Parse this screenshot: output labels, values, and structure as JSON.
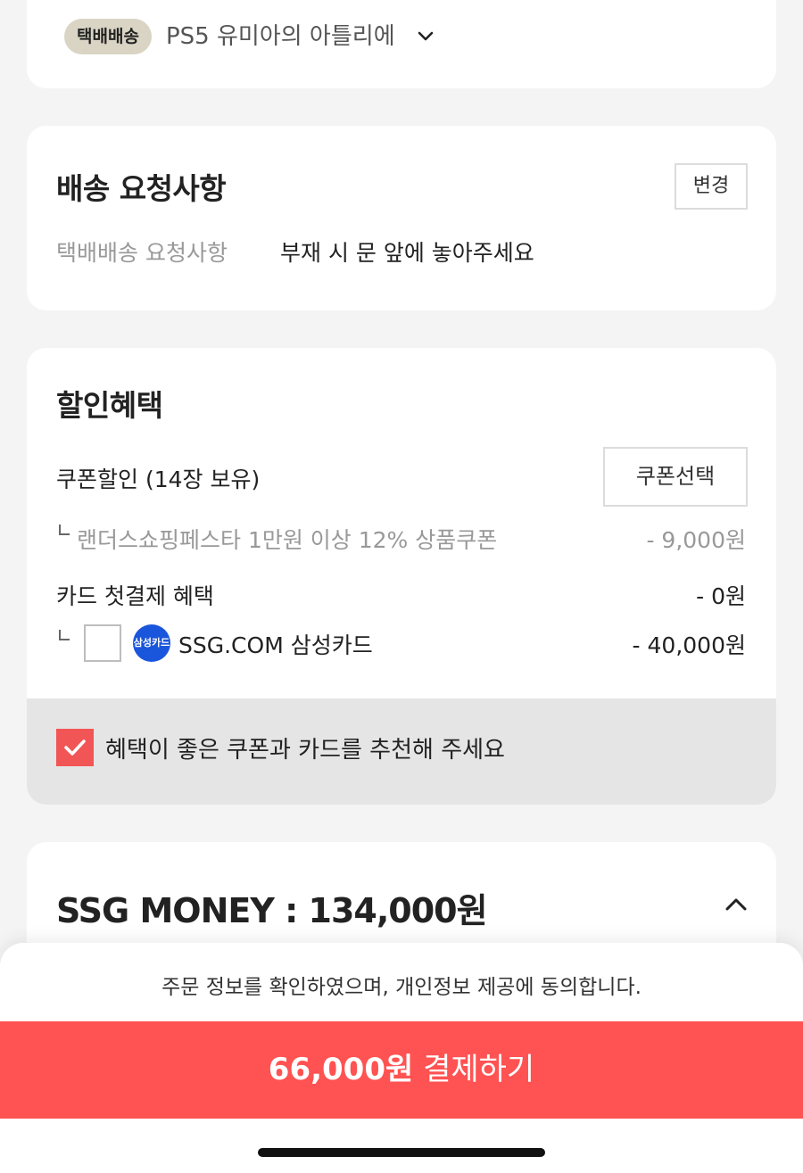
{
  "address": {
    "badge": "택배배송",
    "text": "PS5 유미아의 아틀리에"
  },
  "request": {
    "title": "배송 요청사항",
    "change_label": "변경",
    "label": "택배배송 요청사항",
    "value": "부재 시 문 앞에 놓아주세요"
  },
  "discount": {
    "title": "할인혜택",
    "coupon_label": "쿠폰할인 (14장 보유)",
    "coupon_button": "쿠폰선택",
    "coupon_item": "랜더스쇼핑페스타 1만원 이상 12% 상품쿠폰",
    "coupon_amount": "- 9,000원",
    "card_label": "카드 첫결제 혜택",
    "card_amount": "- 0원",
    "card_logo": "삼성카드",
    "card_name": "SSG.COM 삼성카드",
    "card_option_amount": "- 40,000원",
    "recommend": "혜택이 좋은 쿠폰과 카드를 추천해 주세요"
  },
  "money": {
    "title": "SSG MONEY : 134,000원"
  },
  "footer": {
    "agree": "주문 정보를 확인하였으며, 개인정보 제공에 동의합니다.",
    "pay_amount": "66,000원",
    "pay_label": "결제하기"
  },
  "colors": {
    "accent": "#ff5252",
    "badge_bg": "#d9d4c4",
    "card_logo_bg": "#1a56db"
  }
}
